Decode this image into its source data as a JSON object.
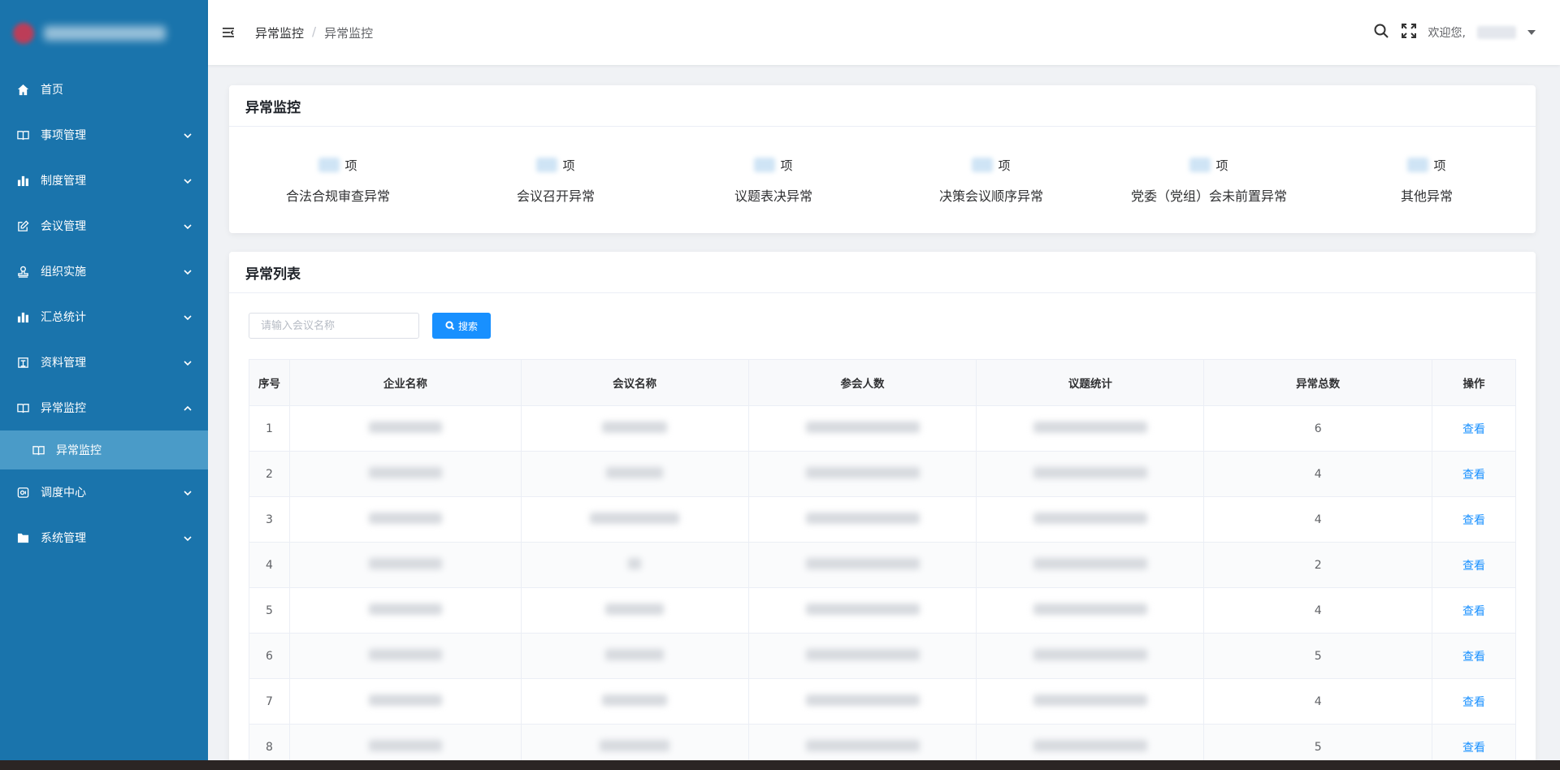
{
  "sidebar": {
    "items": [
      {
        "label": "首页",
        "icon": "home-icon",
        "has_arrow": false
      },
      {
        "label": "事项管理",
        "icon": "book-icon",
        "has_arrow": true
      },
      {
        "label": "制度管理",
        "icon": "bar-chart-icon",
        "has_arrow": true
      },
      {
        "label": "会议管理",
        "icon": "edit-icon",
        "has_arrow": true
      },
      {
        "label": "组织实施",
        "icon": "stamp-icon",
        "has_arrow": true
      },
      {
        "label": "汇总统计",
        "icon": "bar-chart-icon",
        "has_arrow": true
      },
      {
        "label": "资料管理",
        "icon": "document-icon",
        "has_arrow": true
      },
      {
        "label": "异常监控",
        "icon": "book-icon",
        "has_arrow": true,
        "expanded": true
      }
    ],
    "sub_item": {
      "label": "异常监控",
      "icon": "book-icon"
    },
    "items_after": [
      {
        "label": "调度中心",
        "icon": "dispatch-icon",
        "has_arrow": true
      },
      {
        "label": "系统管理",
        "icon": "folder-icon",
        "has_arrow": true
      }
    ]
  },
  "header": {
    "breadcrumb": [
      "异常监控",
      "异常监控"
    ],
    "breadcrumb_sep": "/",
    "welcome": "欢迎您,"
  },
  "summary": {
    "title": "异常监控",
    "unit": "项",
    "items": [
      {
        "label": "合法合规审查异常"
      },
      {
        "label": "会议召开异常"
      },
      {
        "label": "议题表决异常"
      },
      {
        "label": "决策会议顺序异常"
      },
      {
        "label": "党委（党组）会未前置异常"
      },
      {
        "label": "其他异常"
      }
    ]
  },
  "list": {
    "title": "异常列表",
    "search_placeholder": "请输入会议名称",
    "search_button": "搜索",
    "columns": [
      "序号",
      "企业名称",
      "会议名称",
      "参会人数",
      "议题统计",
      "异常总数",
      "操作"
    ],
    "rows": [
      {
        "index": "1",
        "total": "6",
        "action": "查看"
      },
      {
        "index": "2",
        "total": "4",
        "action": "查看"
      },
      {
        "index": "3",
        "total": "4",
        "action": "查看"
      },
      {
        "index": "4",
        "total": "2",
        "action": "查看"
      },
      {
        "index": "5",
        "total": "4",
        "action": "查看"
      },
      {
        "index": "6",
        "total": "5",
        "action": "查看"
      },
      {
        "index": "7",
        "total": "4",
        "action": "查看"
      },
      {
        "index": "8",
        "total": "5",
        "action": "查看"
      }
    ]
  },
  "colors": {
    "sidebar": "#1a74ac",
    "sidebar_active": "#4a9bc8",
    "primary": "#1890ff"
  }
}
